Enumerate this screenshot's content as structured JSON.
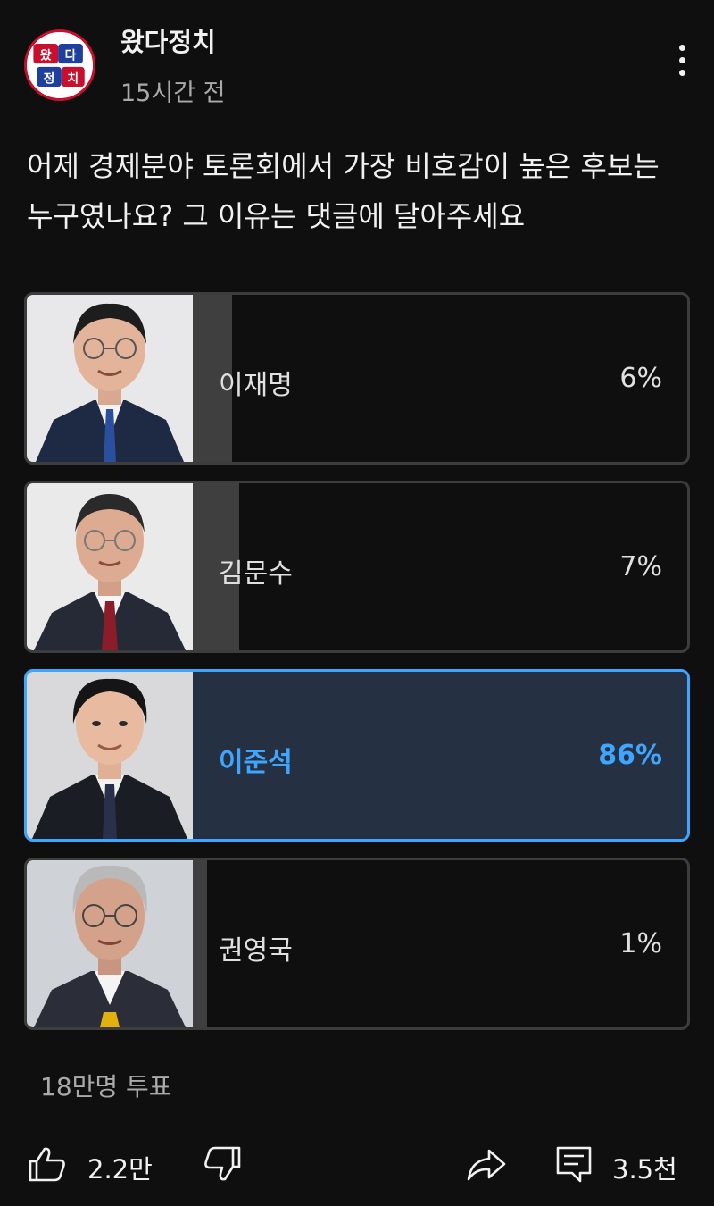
{
  "channel": {
    "name": "왔다정치",
    "time": "15시간 전",
    "logo_text": "왔다정치"
  },
  "question": "어제 경제분야 토론회에서 가장 비호감이 높은 후보는 누구였나요? 그 이유는 댓글에 달아주세요",
  "options": [
    {
      "label": "이재명",
      "percent": "6%",
      "fill_fraction": 0.06,
      "selected": false
    },
    {
      "label": "김문수",
      "percent": "7%",
      "fill_fraction": 0.07,
      "selected": false
    },
    {
      "label": "이준석",
      "percent": "86%",
      "fill_fraction": 0.86,
      "selected": true
    },
    {
      "label": "권영국",
      "percent": "1%",
      "fill_fraction": 0.01,
      "selected": false
    }
  ],
  "votes": "18만명 투표",
  "actions": {
    "like_count": "2.2만",
    "comment_count": "3.5천"
  },
  "icons": [
    "more-vertical-icon",
    "thumbs-up-icon",
    "thumbs-down-icon",
    "share-icon",
    "comment-icon"
  ],
  "colors": {
    "accent": "#3ea6ff",
    "background": "#0f0f0f",
    "bar": "#3f3f3f",
    "selected_bar": "#263043"
  }
}
